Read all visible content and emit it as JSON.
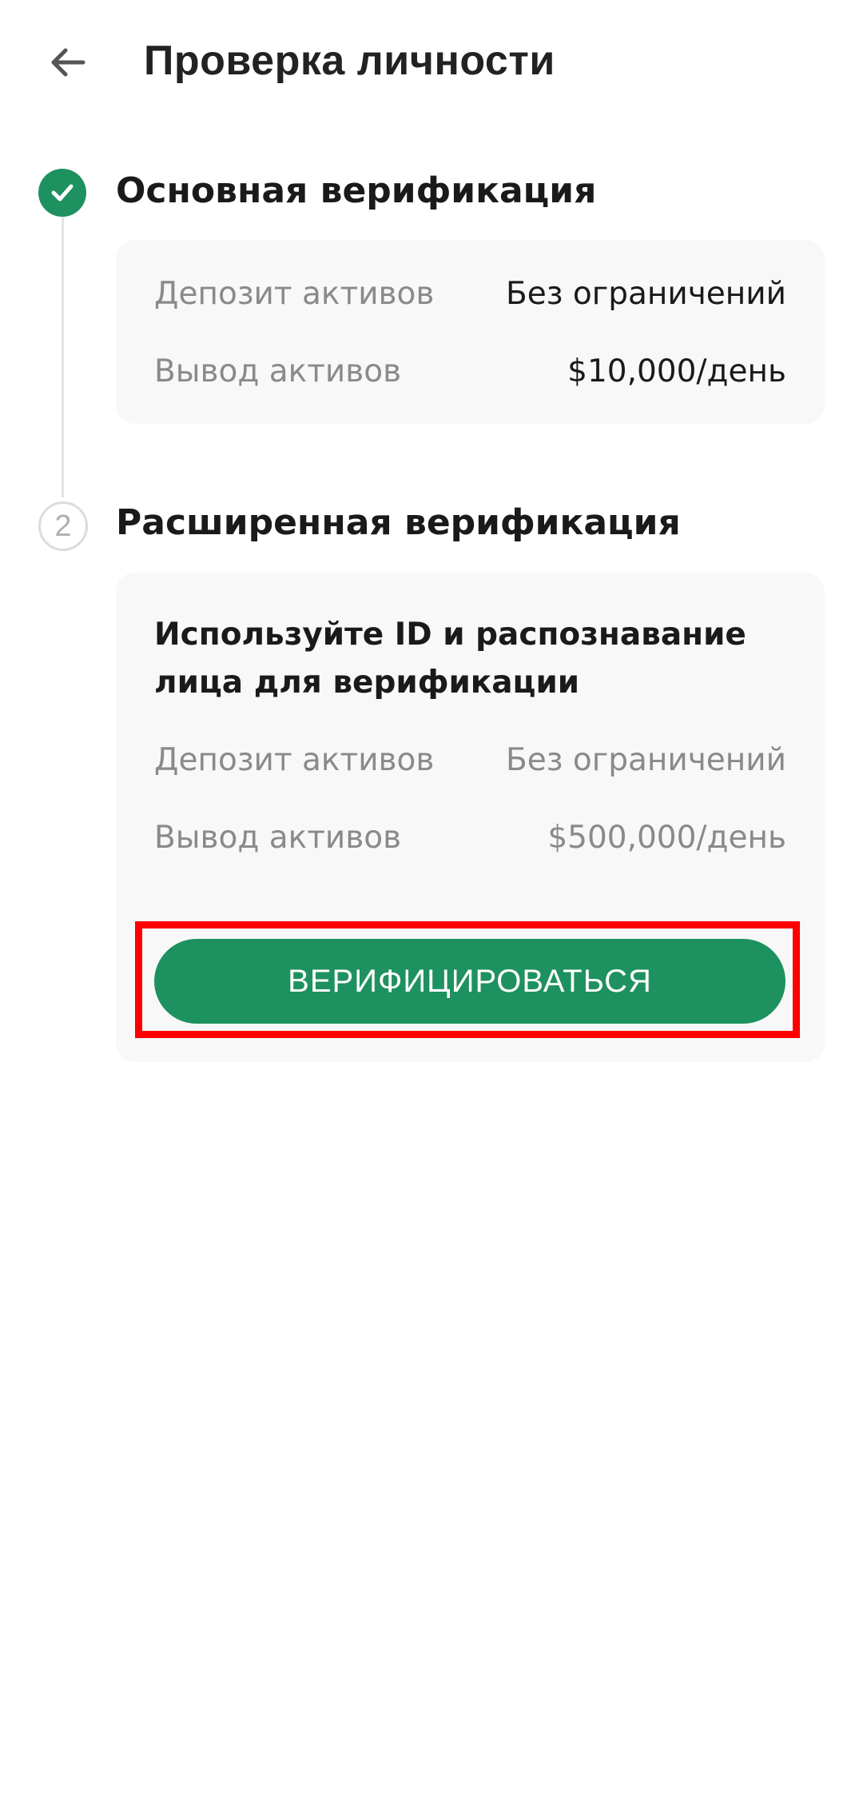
{
  "header": {
    "title": "Проверка личности",
    "back_icon": "arrow-left-icon"
  },
  "steps": [
    {
      "status": "completed",
      "indicator_icon": "check-icon",
      "title": "Основная верификация",
      "rows": [
        {
          "label": "Депозит активов",
          "value": "Без ограничений"
        },
        {
          "label": "Вывод активов",
          "value": "$10,000/день"
        }
      ]
    },
    {
      "status": "pending",
      "number": "2",
      "title": "Расширенная верификация",
      "description": "Используйте ID и распознавание лица для верификации",
      "rows": [
        {
          "label": "Депозит активов",
          "value": "Без ограничений"
        },
        {
          "label": "Вывод активов",
          "value": "$500,000/день"
        }
      ],
      "button_label": "ВЕРИФИЦИРОВАТЬСЯ"
    }
  ],
  "colors": {
    "accent": "#1e9160",
    "highlight": "#ff0000",
    "card_bg": "#f8f8f8"
  }
}
